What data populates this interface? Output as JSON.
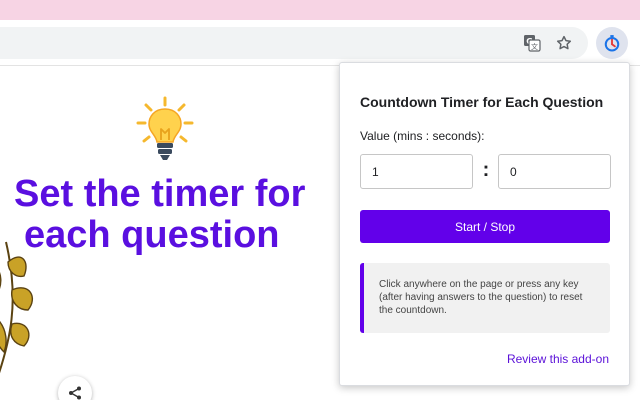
{
  "browser": {
    "icons": {
      "translate": "translate-icon",
      "bookmark": "star-icon",
      "extension": "stopwatch-icon"
    }
  },
  "page": {
    "headline_line1": "Set the timer for",
    "headline_line2": "each question",
    "icons": {
      "bulb": "lightbulb-icon",
      "leaf": "leaf-ornament",
      "share": "share-icon"
    }
  },
  "popup": {
    "title": "Countdown Timer for Each Question",
    "value_label": "Value (mins : seconds):",
    "minutes_value": "1",
    "seconds_value": "0",
    "separator": ":",
    "start_stop_label": "Start / Stop",
    "note": "Click anywhere on the page or press any key (after having answers to the question) to reset the countdown.",
    "review_link": "Review this add-on"
  },
  "colors": {
    "accent": "#6200ea",
    "headline": "#5a0fe0",
    "top_strip": "#f7d4e4"
  }
}
